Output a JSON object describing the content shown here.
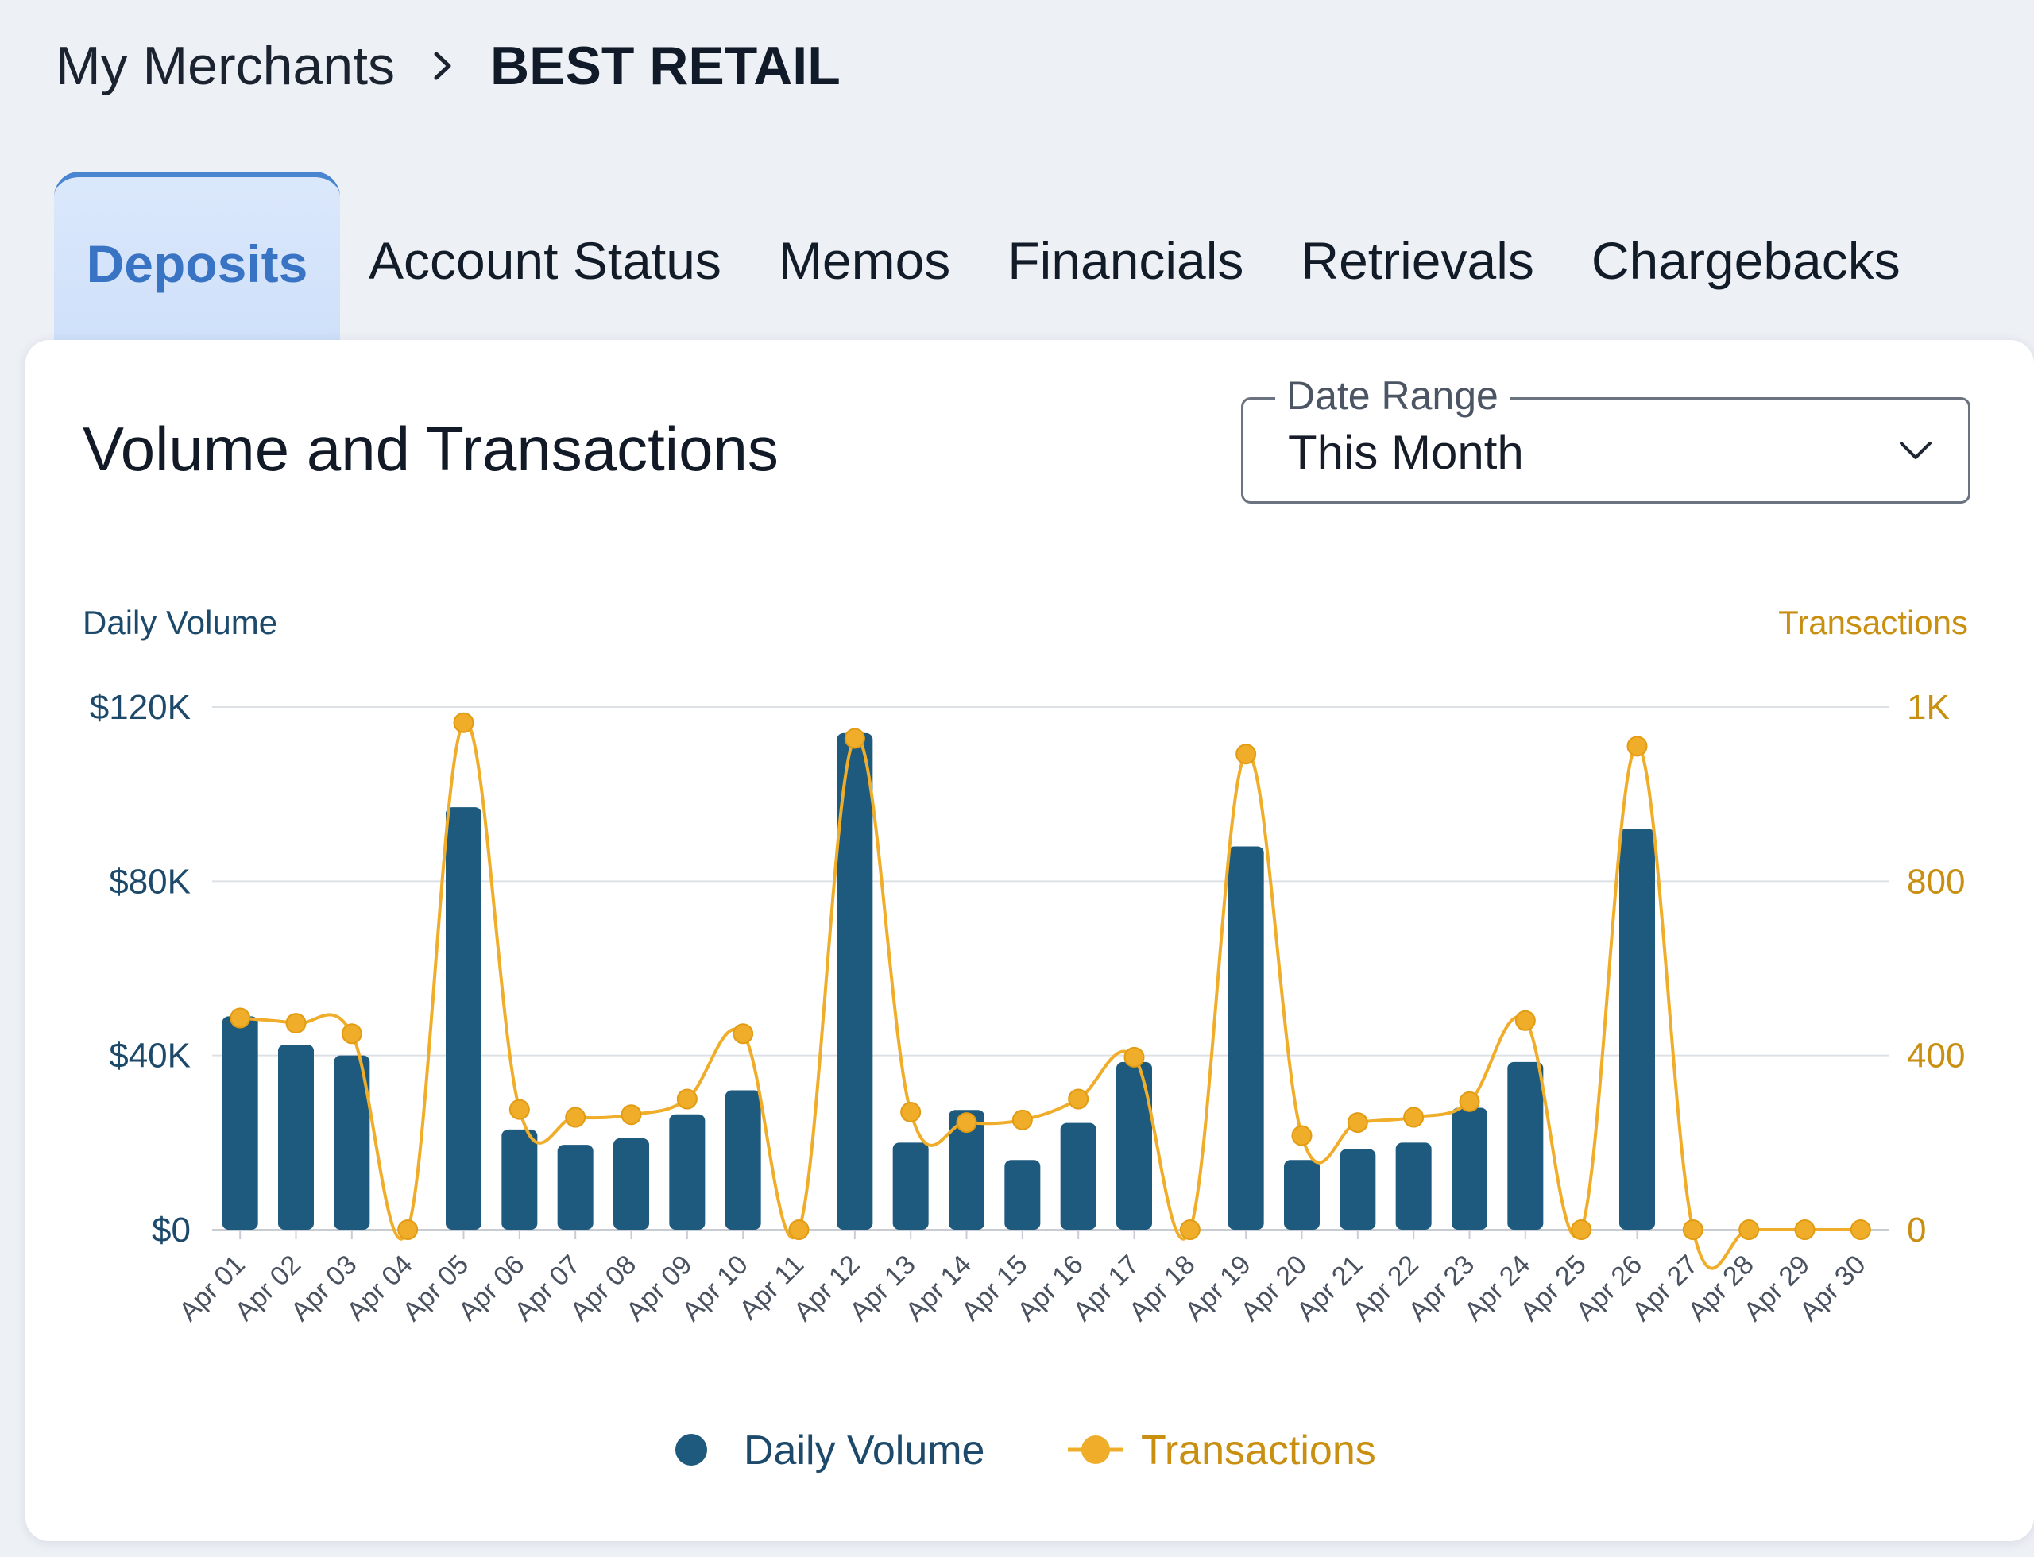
{
  "breadcrumb": {
    "parent": "My Merchants",
    "current": "BEST RETAIL"
  },
  "tabs": [
    {
      "label": "Deposits",
      "active": true
    },
    {
      "label": "Account Status",
      "active": false
    },
    {
      "label": "Memos",
      "active": false
    },
    {
      "label": "Financials",
      "active": false
    },
    {
      "label": "Retrievals",
      "active": false
    },
    {
      "label": "Chargebacks",
      "active": false
    }
  ],
  "card": {
    "title": "Volume and Transactions"
  },
  "date_range": {
    "label": "Date Range",
    "value": "This Month"
  },
  "colors": {
    "volume": "#1e5a7e",
    "transactions": "#f0ad2a",
    "volume_text": "#1d4a6b",
    "transactions_text": "#c88f10"
  },
  "chart_data": {
    "type": "bar",
    "title": "",
    "y_left_label": "Daily Volume",
    "y_right_label": "Transactions",
    "y_left_ticks": [
      "$0",
      "$40K",
      "$80K",
      "$120K"
    ],
    "y_right_ticks": [
      "0",
      "400",
      "800",
      "1K"
    ],
    "y_left_range": [
      0,
      120000
    ],
    "y_right_range": [
      0,
      1000
    ],
    "grid": true,
    "legend_position": "bottom-center",
    "categories": [
      "Apr 01",
      "Apr 02",
      "Apr 03",
      "Apr 04",
      "Apr 05",
      "Apr 06",
      "Apr 07",
      "Apr 08",
      "Apr 09",
      "Apr 10",
      "Apr 11",
      "Apr 12",
      "Apr 13",
      "Apr 14",
      "Apr 15",
      "Apr 16",
      "Apr 17",
      "Apr 18",
      "Apr 19",
      "Apr 20",
      "Apr 21",
      "Apr 22",
      "Apr 23",
      "Apr 24",
      "Apr 25",
      "Apr 26",
      "Apr 27",
      "Apr 28",
      "Apr 29",
      "Apr 30"
    ],
    "series": [
      {
        "name": "Daily Volume",
        "type": "bar",
        "axis": "left",
        "values": [
          49000,
          42500,
          40000,
          0,
          97000,
          23000,
          19500,
          21000,
          26500,
          32000,
          0,
          114000,
          20000,
          27500,
          16000,
          24500,
          38500,
          0,
          88000,
          16000,
          18500,
          20000,
          28000,
          38500,
          0,
          92000,
          0,
          0,
          0,
          0
        ]
      },
      {
        "name": "Transactions",
        "type": "line",
        "axis": "right",
        "values": [
          405,
          395,
          375,
          0,
          970,
          230,
          215,
          220,
          250,
          375,
          0,
          940,
          225,
          205,
          210,
          250,
          330,
          0,
          910,
          180,
          205,
          215,
          245,
          400,
          0,
          925,
          0,
          0,
          0,
          0
        ]
      }
    ]
  }
}
